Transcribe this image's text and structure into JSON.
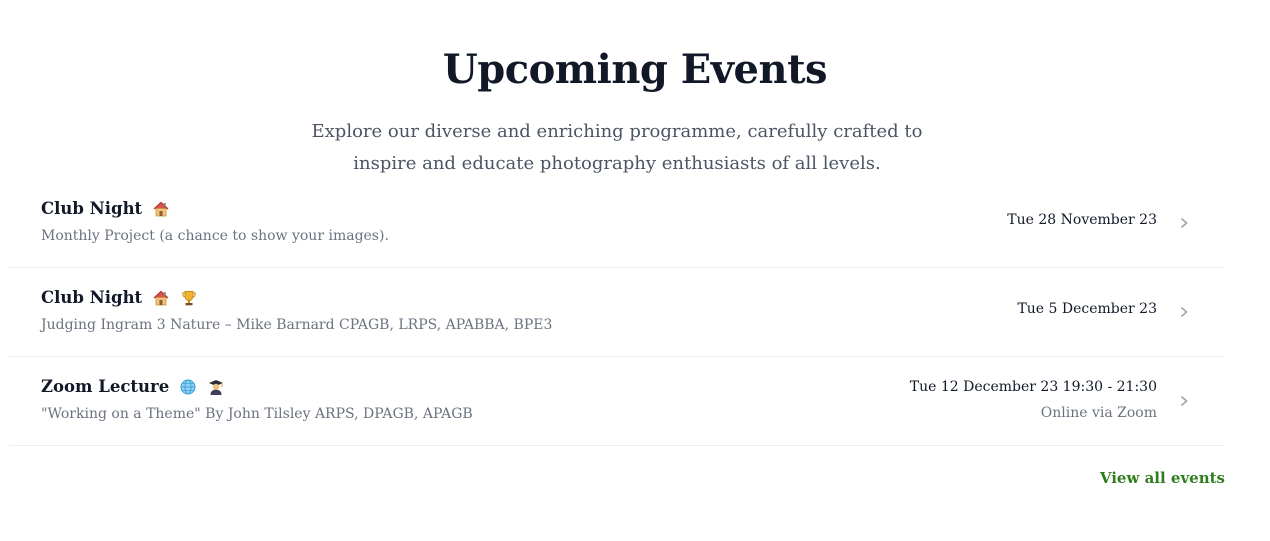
{
  "section": {
    "title": "Upcoming Events",
    "subtitle": "Explore our diverse and enriching programme, carefully crafted to inspire and educate photography enthusiasts of all levels."
  },
  "events": [
    {
      "title": "Club Night",
      "icons": [
        "house-icon"
      ],
      "description": "Monthly Project (a chance to show your images).",
      "date": "Tue 28 November 23",
      "location": ""
    },
    {
      "title": "Club Night",
      "icons": [
        "house-icon",
        "trophy-icon"
      ],
      "description": "Judging Ingram 3 Nature – Mike Barnard CPAGB, LRPS, APABBA, BPE3",
      "date": "Tue 5 December 23",
      "location": ""
    },
    {
      "title": "Zoom Lecture",
      "icons": [
        "globe-icon",
        "graduate-icon"
      ],
      "description": "\"Working on a Theme\" By John Tilsley ARPS, DPAGB, APAGB",
      "date": "Tue 12 December 23 19:30 - 21:30",
      "location": "Online via Zoom"
    }
  ],
  "footer": {
    "view_all_label": "View all events"
  },
  "colors": {
    "heading": "#111827",
    "muted": "#6b7280",
    "link": "#2f7d1f",
    "divider": "#eceff3"
  }
}
